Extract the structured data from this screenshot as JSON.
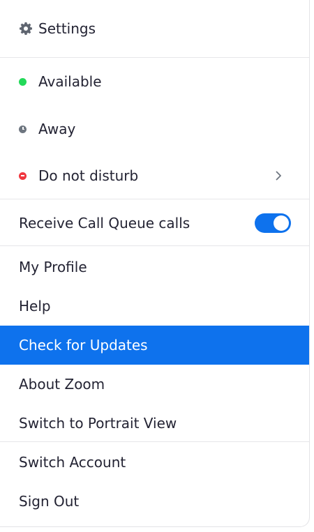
{
  "menu": {
    "settings": {
      "label": "Settings",
      "icon": "gear-icon"
    },
    "status": {
      "available": {
        "label": "Available",
        "color": "#23d959"
      },
      "away": {
        "label": "Away",
        "color": "#6e7680"
      },
      "do_not_disturb": {
        "label": "Do not disturb",
        "color": "#f0373f"
      }
    },
    "call_queue": {
      "label": "Receive Call Queue calls",
      "enabled": true,
      "toggle_color": "#0e72ed"
    },
    "my_profile": {
      "label": "My Profile"
    },
    "help": {
      "label": "Help"
    },
    "check_updates": {
      "label": "Check for Updates",
      "highlight_color": "#0e72ed"
    },
    "about": {
      "label": "About Zoom"
    },
    "portrait_view": {
      "label": "Switch to Portrait View"
    },
    "switch_account": {
      "label": "Switch Account"
    },
    "sign_out": {
      "label": "Sign Out"
    }
  }
}
